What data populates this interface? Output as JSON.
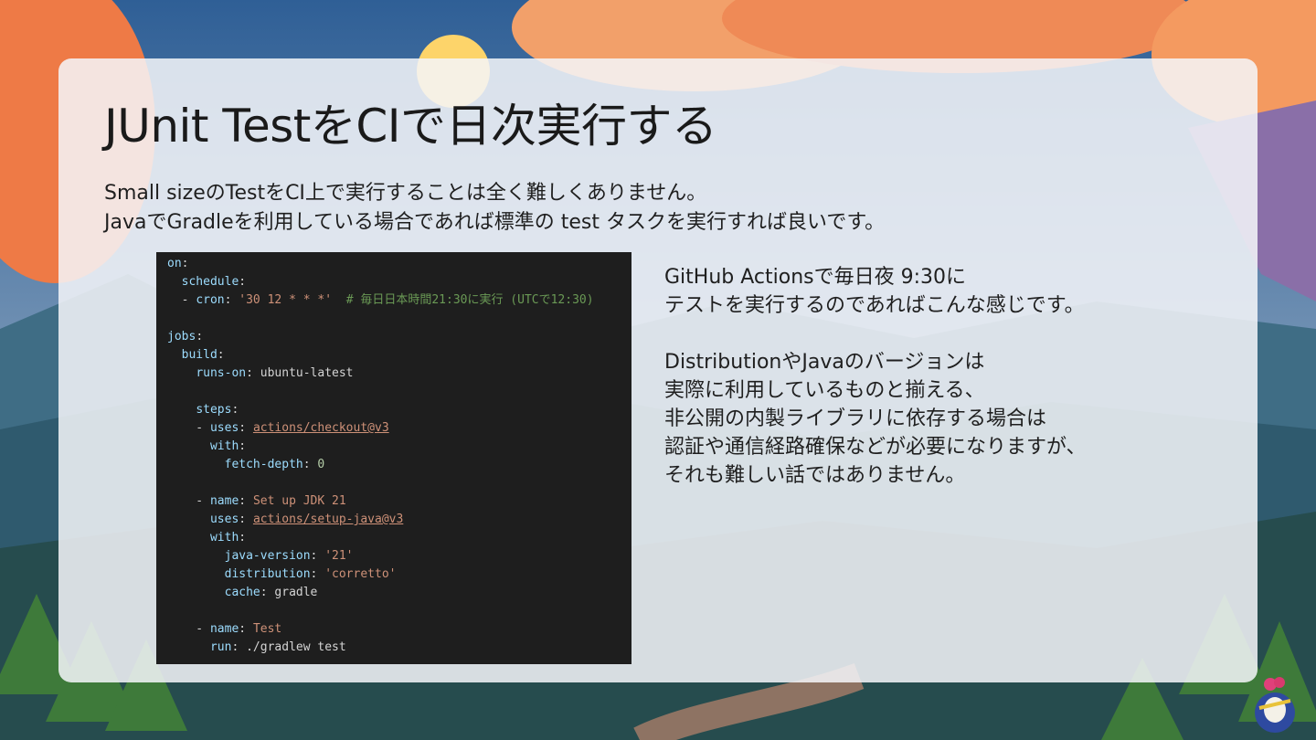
{
  "slide": {
    "title": "JUnit TestをCIで日次実行する",
    "intro_lines": [
      "Small sizeのTestをCI上で実行することは全く難しくありません。",
      "JavaでGradleを利用している場合であれば標準の test タスクを実行すれば良いです。"
    ],
    "side_paragraphs": [
      [
        "GitHub Actionsで毎日夜 9:30に",
        "テストを実行するのであればこんな感じです。"
      ],
      [
        "DistributionやJavaのバージョンは",
        "実際に利用しているものと揃える、",
        "非公開の内製ライブラリに依存する場合は",
        "認証や通信経路確保などが必要になりますが、",
        "それも難しい話ではありません。"
      ]
    ]
  },
  "code": {
    "on": "on",
    "schedule": "schedule",
    "cron_key": "cron",
    "cron_value": "'30 12 * * *'",
    "cron_comment": "# 毎日日本時間21:30に実行 (UTCで12:30)",
    "jobs": "jobs",
    "build": "build",
    "runs_on_key": "runs-on",
    "runs_on_value": "ubuntu-latest",
    "steps": "steps",
    "uses_key": "uses",
    "checkout": "actions/checkout@v3",
    "with": "with",
    "fetch_depth_key": "fetch-depth",
    "fetch_depth_value": "0",
    "name_key": "name",
    "setup_name": "Set up JDK 21",
    "setup_java": "actions/setup-java@v3",
    "java_version_key": "java-version",
    "java_version_value": "'21'",
    "distribution_key": "distribution",
    "distribution_value": "'corretto'",
    "cache_key": "cache",
    "cache_value": "gradle",
    "test_name": "Test",
    "run_key": "run",
    "run_value": "./gradlew test"
  },
  "colors": {
    "card": "#f5f6f9",
    "code_bg": "#1e1e1e",
    "sky_top": "#3d6fa6",
    "sun": "#fdd46a",
    "cloud": "#f08a5a",
    "forest": "#2a4a3a"
  },
  "icons": {
    "mascot": "duke-mascot-icon"
  }
}
